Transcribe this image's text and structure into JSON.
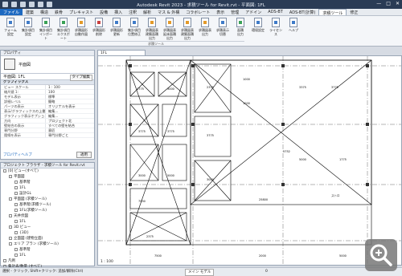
{
  "app": {
    "title": "Autodesk Revit 2023 - 求積ツール for Revit.rvt - 平面図: 1FL",
    "qat_count": 6
  },
  "ribbon": {
    "tabs": [
      "ファイル",
      "建築",
      "構造",
      "鉄骨",
      "プレキャスト",
      "設備",
      "挿入",
      "注釈",
      "解析",
      "マス & 外構",
      "コラボレート",
      "表示",
      "管理",
      "アドイン",
      "ADS-BT",
      "ADS-BT(計算)",
      "求積ツール",
      "修正"
    ],
    "active_tab": "求積ツール",
    "buttons": [
      {
        "label": "フォーム\n設定",
        "color": "b"
      },
      {
        "label": "集計項目\n設定",
        "color": "b"
      },
      {
        "label": "集計項目\nインポート",
        "color": "g"
      },
      {
        "label": "集計項目\nエクスポート",
        "color": "g"
      },
      {
        "label": "求積図形\n自動作図",
        "color": "o"
      },
      {
        "label": "求積図形\n削除",
        "color": "r"
      },
      {
        "label": "求積図形\n更新",
        "color": "b"
      },
      {
        "label": "集計項目\n位置修正",
        "color": "b"
      },
      {
        "label": "求積図表\n建築面積出力",
        "color": "o"
      },
      {
        "label": "求積図表\n延床面積出力",
        "color": "o"
      },
      {
        "label": "求積図表\n建築面積出力",
        "color": "o"
      },
      {
        "label": "求積図表\n出力",
        "color": "o"
      },
      {
        "label": "求積表示\n切替",
        "color": "b"
      },
      {
        "label": "面積\n出力",
        "color": "g"
      },
      {
        "label": "環境設定",
        "color": "b"
      },
      {
        "label": "ライセンス",
        "color": "b"
      },
      {
        "label": "ヘルプ",
        "color": "b"
      }
    ],
    "panel_label": "求積ツール"
  },
  "properties": {
    "header": "プロパティ",
    "type_name": "平面図",
    "instance": "平面図: 1FL",
    "edit_type": "タイプ編集",
    "groups": [
      {
        "name": "グラフィックス",
        "rows": [
          [
            "ビュー スケール",
            "1 : 100"
          ],
          [
            "縮尺値 1:",
            "100"
          ],
          [
            "モデル表示",
            "標準"
          ],
          [
            "詳細レベル",
            "簡略"
          ],
          [
            "パーツの表示",
            "オリジナルを表示"
          ],
          [
            "表示/グラフィックスの上書き",
            "編集..."
          ],
          [
            "グラフィック表示オプション",
            "編集..."
          ],
          [
            "方向",
            "プロジェクト北"
          ],
          [
            "壁結合の表示",
            "すべての壁を結合"
          ],
          [
            "専門分野",
            "意匠"
          ],
          [
            "隠線を表示",
            "専門分野ごと"
          ]
        ]
      }
    ],
    "help": "プロパティヘルプ",
    "apply": "適用"
  },
  "browser": {
    "header": "プロジェクト ブラウザ - 求積ツール for Revit.rvt",
    "items": [
      {
        "d": 0,
        "t": "[0] ビュー(すべて)"
      },
      {
        "d": 1,
        "t": "平面図"
      },
      {
        "d": 2,
        "t": "基準階"
      },
      {
        "d": 2,
        "t": "1FL"
      },
      {
        "d": 2,
        "t": "設計GL"
      },
      {
        "d": 1,
        "t": "平面図 (求積ツール)"
      },
      {
        "d": 2,
        "t": "基準階(求積ツール)"
      },
      {
        "d": 2,
        "t": "1FL(求積ツール)"
      },
      {
        "d": 1,
        "t": "天井伏図"
      },
      {
        "d": 2,
        "t": "1FL"
      },
      {
        "d": 1,
        "t": "3D ビュー"
      },
      {
        "d": 2,
        "t": "{3D}"
      },
      {
        "d": 1,
        "t": "立面図 (建物立面)"
      },
      {
        "d": 1,
        "t": "エリア プラン (求積ツール)"
      },
      {
        "d": 2,
        "t": "基準階"
      },
      {
        "d": 2,
        "t": "1FL"
      },
      {
        "d": 0,
        "t": "凡例"
      },
      {
        "d": 0,
        "t": "集計表/数量 (すべて)"
      },
      {
        "d": 0,
        "t": "シート (すべて)"
      }
    ]
  },
  "view": {
    "tab": "1FL",
    "labels": [
      "1775",
      "3000",
      "3775",
      "3775",
      "3000",
      "5000",
      "7500",
      "2375",
      "2375",
      "3775",
      "3000",
      "1000",
      "1000",
      "3375",
      "3775",
      "5000",
      "1775",
      "25800",
      "5752",
      "ストロ",
      "7500",
      "2000",
      "5000"
    ],
    "scale_bar": "1 : 100"
  },
  "status": {
    "text": "選択 - クリック, Shift+クリック: 追加/解除(Ctrl)",
    "model": "メイン モデル",
    "right": "0"
  }
}
